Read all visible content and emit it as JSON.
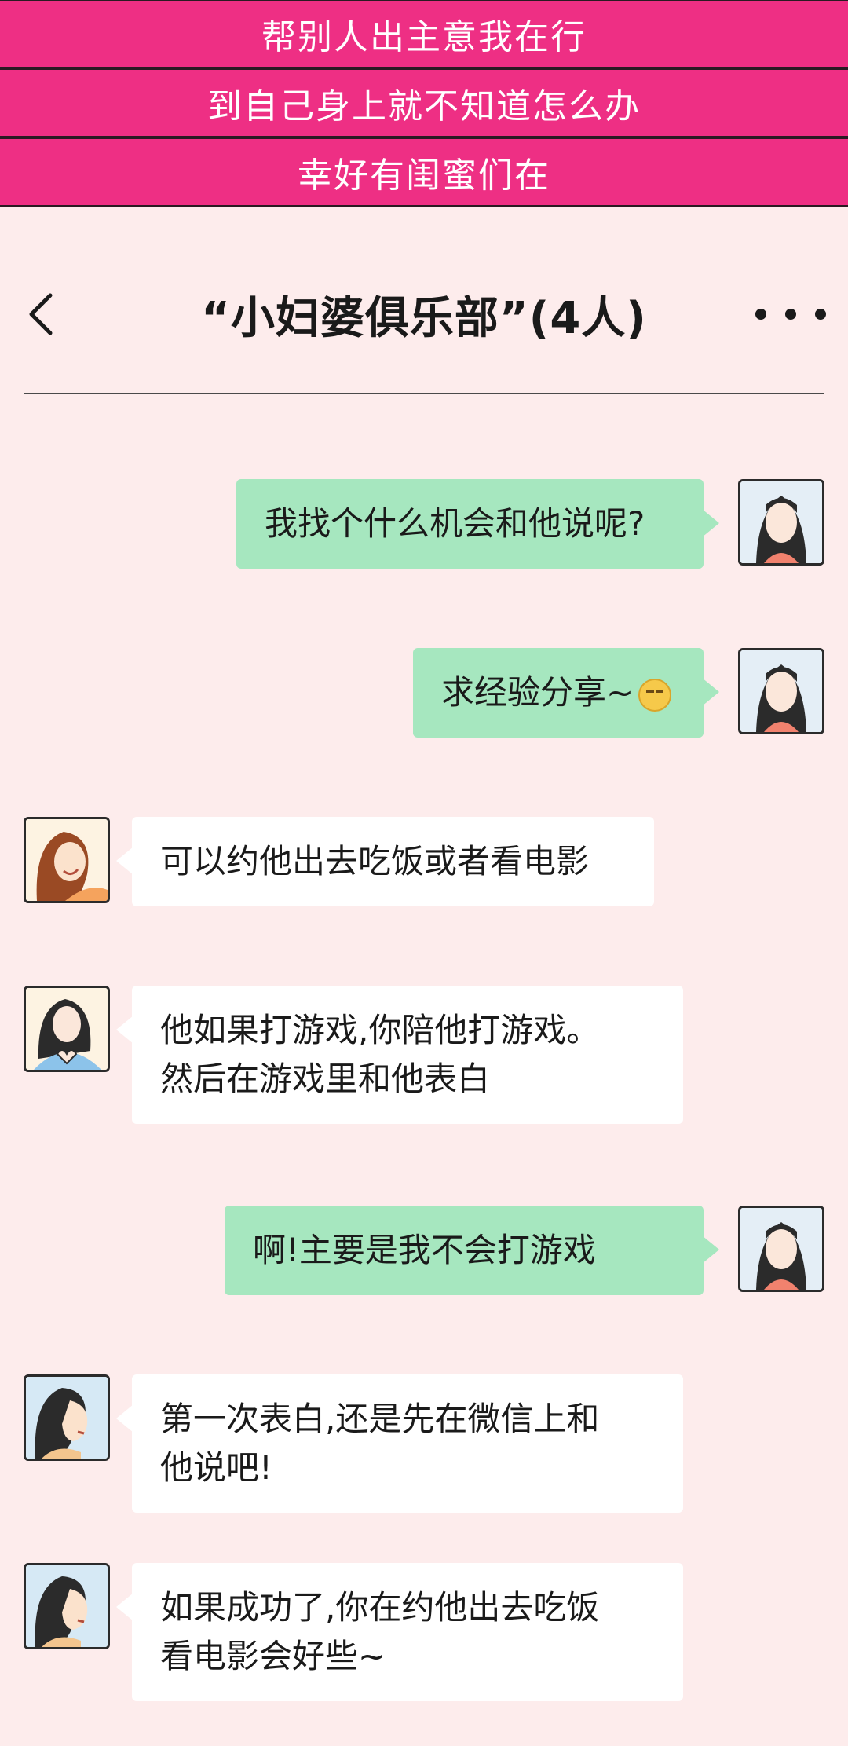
{
  "banner": {
    "lines": [
      "帮别人出主意我在行",
      "到自己身上就不知道怎么办",
      "幸好有闺蜜们在"
    ]
  },
  "header": {
    "back_icon": "chevron-left-icon",
    "title": "“小妇婆俱乐部”(4人)",
    "more_icon": "more-dots-icon"
  },
  "messages": [
    {
      "side": "right",
      "text": "我找个什么机会和他说呢?",
      "avatar": "long-hair-woman"
    },
    {
      "side": "right",
      "text": "求经验分享~",
      "emoji": "nervous-face-emoji",
      "avatar": "long-hair-woman"
    },
    {
      "side": "left",
      "text": "可以约他出去吃饭或者看电影",
      "avatar": "smiling-woman"
    },
    {
      "side": "left",
      "text": "他如果打游戏,你陪他打游戏。\n然后在游戏里和他表白",
      "avatar": "heart-hands-woman"
    },
    {
      "side": "right",
      "text": "啊!主要是我不会打游戏",
      "avatar": "long-hair-woman"
    },
    {
      "side": "left",
      "text": "第一次表白,还是先在微信上和\n他说吧!",
      "avatar": "profile-woman"
    },
    {
      "side": "left",
      "text": "如果成功了,你在约他出去吃饭\n看电影会好些~",
      "avatar": "profile-woman"
    }
  ],
  "colors": {
    "banner": "#ee2f84",
    "background": "#fdecec",
    "my_bubble": "#a6e7bf",
    "other_bubble": "#ffffff"
  }
}
